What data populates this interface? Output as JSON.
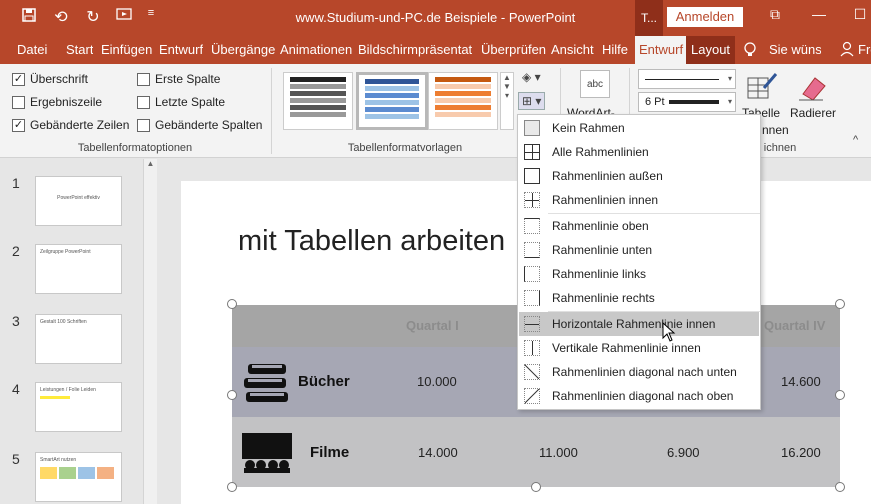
{
  "titlebar": {
    "title": "www.Studium-und-PC.de Beispiele  -  PowerPoint",
    "context_tab": "T...",
    "login": "Anmelden",
    "qat_icons": [
      "save-icon",
      "undo-icon",
      "redo-icon",
      "present-icon",
      "customize-icon"
    ]
  },
  "tabs": [
    "Datei",
    "Start",
    "Einfügen",
    "Entwurf",
    "Übergänge",
    "Animationen",
    "Bildschirmpräsentatio",
    "Überprüfen",
    "Ansicht",
    "Hilfe",
    "Entwurf",
    "Layout",
    "Sie wünsc",
    "Fre"
  ],
  "ribbon": {
    "options": {
      "checks": [
        {
          "label": "Überschrift",
          "checked": true
        },
        {
          "label": "Erste Spalte",
          "checked": false
        },
        {
          "label": "Ergebniszeile",
          "checked": false
        },
        {
          "label": "Letzte Spalte",
          "checked": false
        },
        {
          "label": "Gebänderte Zeilen",
          "checked": true
        },
        {
          "label": "Gebänderte Spalten",
          "checked": false
        }
      ],
      "group_label": "Tabellenformatoptionen"
    },
    "styles_group_label": "Tabellenformatvorlagen",
    "wordart_label": "WordArt-",
    "pen_weight": "6 Pt",
    "tabelle_label": "Tabelle",
    "tabelle_label2": "nnen",
    "radierer_label": "Radierer",
    "draw_group_label": "ichnen"
  },
  "thumbs": [
    {
      "num": "1",
      "text": "PowerPoint effektiv"
    },
    {
      "num": "2",
      "text": "Zeilgruppe PowerPoint"
    },
    {
      "num": "3",
      "text": "Gestalt 100 Schriften"
    },
    {
      "num": "4",
      "text": "Leistungen / Folie Leiden"
    },
    {
      "num": "5",
      "text": "SmartArt nutzen"
    }
  ],
  "slide": {
    "title": "mit Tabellen arbeiten",
    "header_cols": [
      "Quartal I",
      "Quartal IV"
    ],
    "rows": [
      {
        "label": "Bücher",
        "values": [
          "10.000",
          "14.600"
        ]
      },
      {
        "label": "Filme",
        "values": [
          "14.000",
          "11.000",
          "6.900",
          "16.200"
        ]
      }
    ]
  },
  "dropdown": {
    "items": [
      "Kein Rahmen",
      "Alle Rahmenlinien",
      "Rahmenlinien außen",
      "Rahmenlinien innen",
      "Rahmenlinie oben",
      "Rahmenlinie unten",
      "Rahmenlinie links",
      "Rahmenlinie rechts",
      "Horizontale Rahmenlinie innen",
      "Vertikale Rahmenlinie innen",
      "Rahmenlinien diagonal nach unten",
      "Rahmenlinien diagonal nach oben"
    ],
    "highlighted": "Horizontale Rahmenlinie innen"
  },
  "colors": {
    "accent": "#b7472a",
    "dark_accent": "#8f2f1a",
    "ribbon_bg": "#f3f3f3",
    "table_header": "#a5a5a5"
  }
}
